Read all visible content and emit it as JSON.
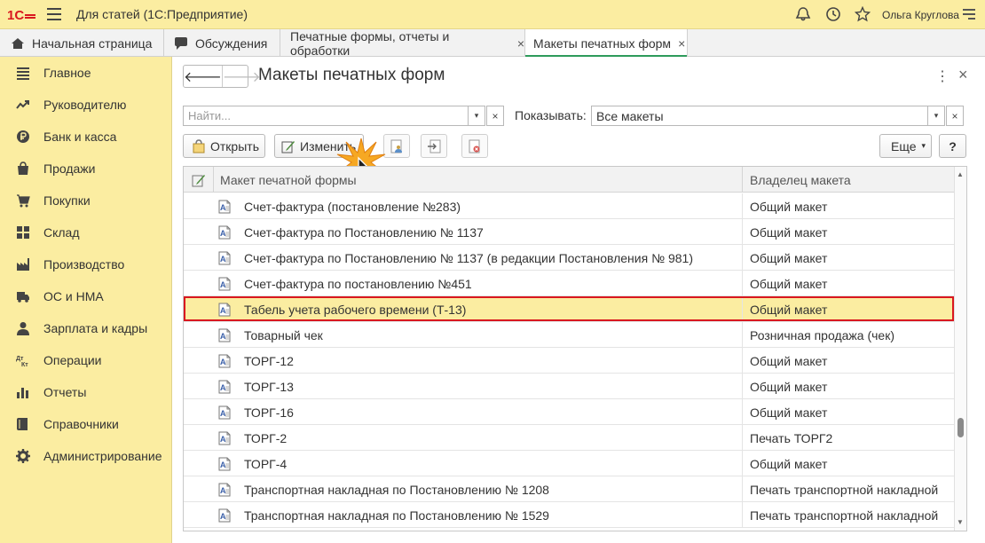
{
  "titlebar": {
    "logo_text": "1С",
    "title": "Для статей  (1С:Предприятие)",
    "user": "Ольга Круглова",
    "icons": [
      "bell-icon",
      "history-icon",
      "star-icon",
      "menu-icon"
    ]
  },
  "tabs": [
    {
      "label": "Начальная страница",
      "icon": "home-icon"
    },
    {
      "label": "Обсуждения",
      "icon": "chat-icon"
    },
    {
      "label": "Печатные формы, отчеты и обработки",
      "close": "×"
    },
    {
      "label": "Макеты печатных форм",
      "close": "×",
      "active": true
    }
  ],
  "sidebar": {
    "items": [
      {
        "label": "Главное",
        "icon": "list-icon"
      },
      {
        "label": "Руководителю",
        "icon": "trend-icon"
      },
      {
        "label": "Банк и касса",
        "icon": "ruble-coin-icon"
      },
      {
        "label": "Продажи",
        "icon": "bag-icon"
      },
      {
        "label": "Покупки",
        "icon": "cart-icon"
      },
      {
        "label": "Склад",
        "icon": "grid-icon"
      },
      {
        "label": "Производство",
        "icon": "factory-icon"
      },
      {
        "label": "ОС и НМА",
        "icon": "truck-icon"
      },
      {
        "label": "Зарплата и кадры",
        "icon": "person-icon"
      },
      {
        "label": "Операции",
        "icon": "debit-credit-icon"
      },
      {
        "label": "Отчеты",
        "icon": "bar-chart-icon"
      },
      {
        "label": "Справочники",
        "icon": "book-icon"
      },
      {
        "label": "Администрирование",
        "icon": "gear-icon"
      }
    ]
  },
  "main": {
    "title": "Макеты печатных форм",
    "back": "🡐",
    "forward": "🡒",
    "kebab": "⋮",
    "close": "×",
    "search_placeholder": "Найти...",
    "search_dd": "▾",
    "search_clear": "×",
    "show_label": "Показывать:",
    "show_value": "Все макеты",
    "toolbar": {
      "open": "Открыть",
      "edit": "Изменить",
      "more": "Еще",
      "more_arrow": "▾",
      "help": "?"
    }
  },
  "table": {
    "columns": [
      "Макет печатной формы",
      "Владелец макета"
    ],
    "rows": [
      {
        "name": "Счет-фактура (постановление №283)",
        "owner": "Общий макет"
      },
      {
        "name": "Счет-фактура по Постановлению № 1137",
        "owner": "Общий макет"
      },
      {
        "name": "Счет-фактура по Постановлению № 1137 (в редакции Постановления № 981)",
        "owner": "Общий макет"
      },
      {
        "name": "Счет-фактура по постановлению №451",
        "owner": "Общий макет"
      },
      {
        "name": "Табель учета рабочего времени (Т-13)",
        "owner": "Общий макет",
        "selected": true
      },
      {
        "name": "Товарный чек",
        "owner": "Розничная продажа (чек)"
      },
      {
        "name": "ТОРГ-12",
        "owner": "Общий макет"
      },
      {
        "name": "ТОРГ-13",
        "owner": "Общий макет"
      },
      {
        "name": "ТОРГ-16",
        "owner": "Общий макет"
      },
      {
        "name": "ТОРГ-2",
        "owner": "Печать ТОРГ2"
      },
      {
        "name": "ТОРГ-4",
        "owner": "Общий макет"
      },
      {
        "name": "Транспортная накладная по Постановлению № 1208",
        "owner": "Печать транспортной накладной"
      },
      {
        "name": "Транспортная накладная по Постановлению № 1529",
        "owner": "Печать транспортной накладной"
      }
    ]
  },
  "colors": {
    "accent_yellow": "#fbeda1",
    "selection_border": "#d9181f",
    "active_tab_underline": "#2e9b5b"
  }
}
